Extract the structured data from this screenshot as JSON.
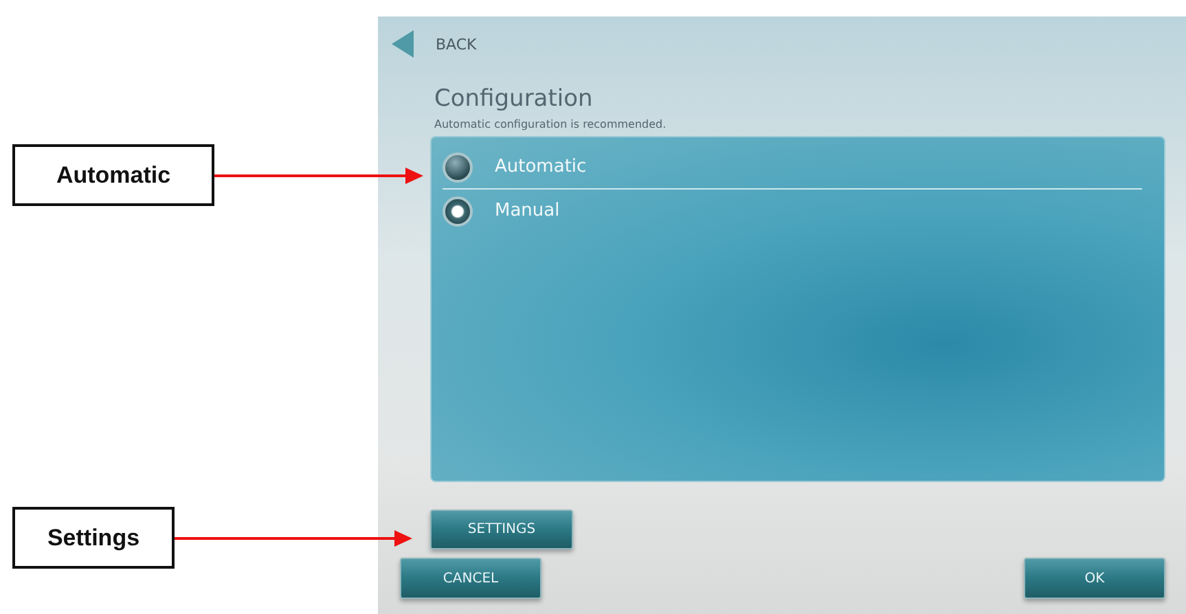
{
  "callouts": [
    {
      "label": "Automatic"
    },
    {
      "label": "Settings"
    }
  ],
  "back": {
    "label": "BACK"
  },
  "title": "Configuration",
  "subtitle": "Automatic configuration is recommended.",
  "options": [
    {
      "label": "Automatic",
      "selected": false,
      "focused": true
    },
    {
      "label": "Manual",
      "selected": true,
      "focused": false
    }
  ],
  "settings_button": {
    "label": "SETTINGS"
  },
  "footer_buttons": [
    {
      "label": "CANCEL"
    },
    {
      "label": "OK"
    }
  ]
}
